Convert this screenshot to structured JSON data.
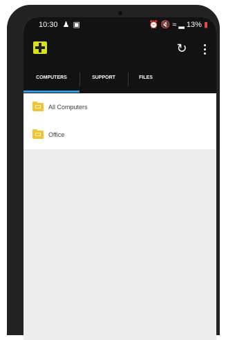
{
  "status_bar": {
    "time": "10:30",
    "left_icons": [
      "person-icon",
      "message-icon"
    ],
    "right_icons": [
      "alarm-icon",
      "mute-icon",
      "wifi-icon",
      "signal-icon"
    ],
    "battery": "13%"
  },
  "app_bar": {
    "logo": "app-logo",
    "actions": [
      "refresh-icon",
      "more-vert-icon"
    ]
  },
  "tabs": [
    {
      "label": "COMPUTERS",
      "selected": true
    },
    {
      "label": "SUPPORT",
      "selected": false
    },
    {
      "label": "FILES",
      "selected": false
    }
  ],
  "list": {
    "items": [
      {
        "label": "All Computers",
        "icon": "folder-icon"
      },
      {
        "label": "Office",
        "icon": "folder-icon"
      }
    ]
  },
  "colors": {
    "bar_bg": "#121212",
    "accent": "#2d9de3",
    "logo": "#d8e21b",
    "folder": "#f2c431",
    "content_bg": "#ededed"
  }
}
